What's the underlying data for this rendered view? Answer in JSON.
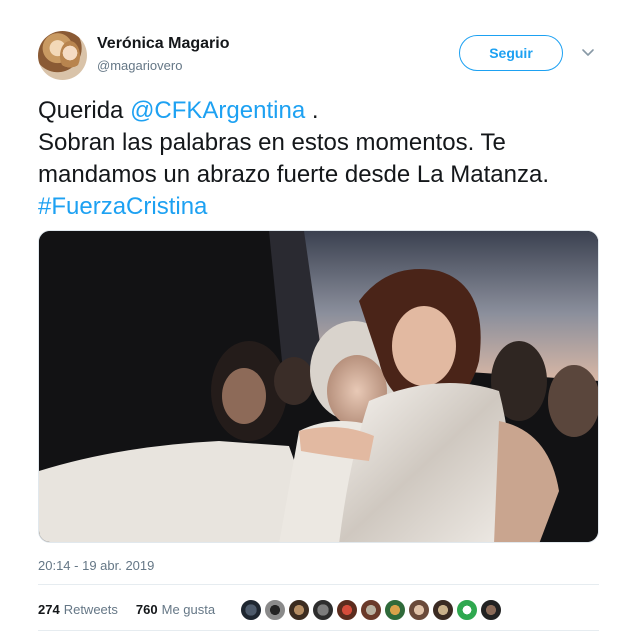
{
  "author": {
    "display_name": "Verónica Magario",
    "handle": "@magariovero"
  },
  "follow_label": "Seguir",
  "tweet": {
    "text_prefix": "Querida ",
    "mention": "@CFKArgentina",
    "text_mid": " .\nSobran las palabras en estos momentos. Te mandamos un abrazo fuerte desde La Matanza. ",
    "hashtag": "#FuerzaCristina"
  },
  "timestamp": "20:14 - 19 abr. 2019",
  "stats": {
    "retweets_count": "274",
    "retweets_label": "Retweets",
    "likes_count": "760",
    "likes_label": "Me gusta"
  },
  "icons": {
    "more": "chevron-down-icon"
  },
  "colors": {
    "accent": "#1da1f2",
    "secondary_text": "#657786",
    "primary_text": "#14171a"
  },
  "likers_count": 11
}
